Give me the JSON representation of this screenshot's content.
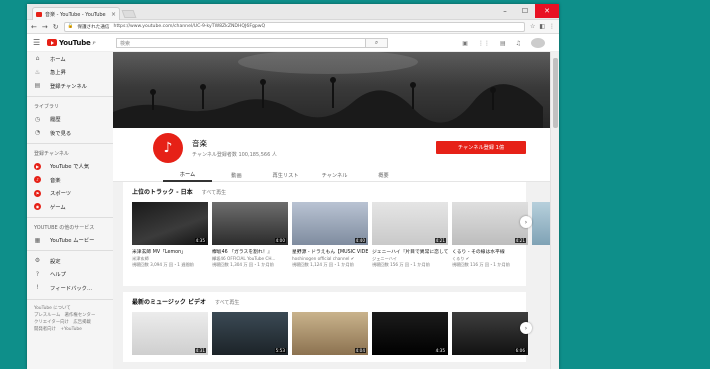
{
  "browser": {
    "tab_title": "音楽 - YouTube - YouTube",
    "tab_close": "×",
    "security_label": "保護された通信",
    "url": "https://www.youtube.com/channel/UC-9-kyTW8ZkZNDHQJ6FgpwQ",
    "win_min": "–",
    "win_max": "☐",
    "win_close": "✕"
  },
  "header": {
    "logo_text": "YouTube",
    "logo_region": "JP",
    "search_placeholder": "検索"
  },
  "sidebar": {
    "main_items": [
      {
        "icon": "home-icon",
        "glyph": "⌂",
        "label": "ホーム"
      },
      {
        "icon": "trending-icon",
        "glyph": "♨",
        "label": "急上昇"
      },
      {
        "icon": "subscriptions-icon",
        "glyph": "▤",
        "label": "登録チャンネル"
      }
    ],
    "library_heading": "ライブラリ",
    "library_items": [
      {
        "icon": "history-icon",
        "glyph": "◷",
        "label": "履歴"
      },
      {
        "icon": "watch-later-icon",
        "glyph": "◔",
        "label": "後で見る"
      }
    ],
    "subs_heading": "登録チャンネル",
    "subs_items": [
      {
        "color": "#e62117",
        "glyph": "▶",
        "label": "YouTube で人気"
      },
      {
        "color": "#e62117",
        "glyph": "♪",
        "label": "音楽"
      },
      {
        "color": "#e62117",
        "glyph": "⚑",
        "label": "スポーツ"
      },
      {
        "color": "#e62117",
        "glyph": "◉",
        "label": "ゲーム"
      }
    ],
    "more_heading": "YOUTUBE の他のサービス",
    "more_items": [
      {
        "icon": "youtube-movies-icon",
        "glyph": "▦",
        "label": "YouTube ムービー"
      }
    ],
    "settings_items": [
      {
        "icon": "settings-icon",
        "glyph": "⚙",
        "label": "設定"
      },
      {
        "icon": "help-icon",
        "glyph": "?",
        "label": "ヘルプ"
      },
      {
        "icon": "feedback-icon",
        "glyph": "!",
        "label": "フィードバック..."
      }
    ],
    "footer": [
      "YouTube について",
      "プレスルーム　著作権センター",
      "クリエイター向け　広告掲載",
      "開発者向け　+YouTube"
    ]
  },
  "channel": {
    "name": "音楽",
    "subscribers": "チャンネル登録者数 100,185,566 人",
    "subscribe_label": "チャンネル登録 1億",
    "tabs": [
      "ホーム",
      "動画",
      "再生リスト",
      "チャンネル",
      "概要"
    ]
  },
  "shelf1": {
    "title": "上位のトラック - 日本",
    "play_all": "すべて再生",
    "videos": [
      {
        "thumb": "t1",
        "duration": "4:35",
        "title": "米津玄師 MV「Lemon」",
        "channel": "米津玄師",
        "views": "視聴回数 3,094 万 回・1 週間前"
      },
      {
        "thumb": "t2",
        "duration": "4:00",
        "title": "欅坂46 『ガラスを割れ！』",
        "channel": "欅坂46 OFFICIAL YouTube CH...",
        "views": "視聴回数 1,304 万 回・1 か月前"
      },
      {
        "thumb": "t3",
        "duration": "4:40",
        "title": "星野源 - ドラえもん【MUSIC VIDEO & 特典DVD予告編】",
        "channel": "hoshinogen official channel ✔",
        "views": "視聴回数 1,124 万 回・1 か月前"
      },
      {
        "thumb": "t4",
        "duration": "4:21",
        "title": "ジェニーハイ『片目で異常に恋してる』",
        "channel": "ジェニーハイ",
        "views": "視聴回数 156 万 回・1 か月前"
      },
      {
        "thumb": "t5",
        "duration": "4:21",
        "title": "くるり - その線は水平線",
        "channel": "くるり ✔",
        "views": "視聴回数 116 万 回・1 か月前"
      },
      {
        "thumb": "t6",
        "duration": "5:45",
        "title": "",
        "channel": "",
        "views": ""
      }
    ]
  },
  "shelf2": {
    "title": "最新のミュージック ビデオ",
    "play_all": "すべて再生",
    "videos": [
      {
        "thumb": "r1",
        "duration": "4:31"
      },
      {
        "thumb": "r2",
        "duration": "5:53"
      },
      {
        "thumb": "r3",
        "duration": "4:04"
      },
      {
        "thumb": "r4",
        "duration": "4:35"
      },
      {
        "thumb": "r5",
        "duration": "6:06"
      }
    ]
  }
}
